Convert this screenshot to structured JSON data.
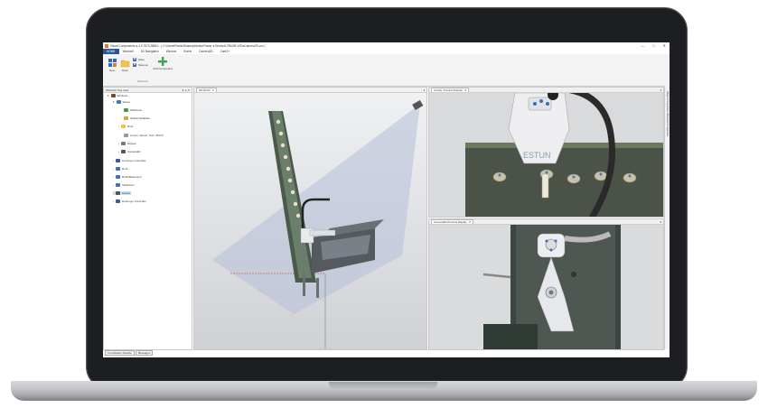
{
  "window": {
    "title": "Visual Components ● 4.0.7873.28810 - [ C:\\Users\\Public\\Desktop\\MotionFlower ● Works41784439.1\\SimCamera2D.vcx ]",
    "controls": [
      "—",
      "□",
      "✕"
    ]
  },
  "menubar": {
    "items": [
      {
        "label": "HOME",
        "active": true
      },
      {
        "label": "Workcell",
        "active": false
      },
      {
        "label": "3D Navigation",
        "active": false
      },
      {
        "label": "Window",
        "active": false
      },
      {
        "label": "Scene",
        "active": false
      },
      {
        "label": "Camera2D",
        "active": false
      },
      {
        "label": "Cam2+",
        "active": false
      }
    ]
  },
  "ribbon": {
    "new_label": "New",
    "open_label": "Open",
    "save_label": "Save",
    "save_as_label": "Save as",
    "add_component_label": "Add Component",
    "group_label": "Workcell"
  },
  "tree_panel": {
    "title": "Workcell Tree view",
    "header_controls": "▾ ⊿ ✕",
    "nodes": [
      {
        "label": "Workcell",
        "level": 0,
        "icon": "workcell-icon",
        "color": "#7a4a2a"
      },
      {
        "label": "Scene",
        "level": 1,
        "icon": "scene-icon",
        "color": "#3f79c4"
      },
      {
        "label": "3DDevice",
        "level": 2,
        "icon": "device-icon",
        "color": "#3f9c46"
      },
      {
        "label": "Global Variables",
        "level": 2,
        "icon": "variables-icon",
        "color": "#d6a43a"
      },
      {
        "label": "Root",
        "level": 2,
        "icon": "folder-icon",
        "color": "#f2c24c"
      },
      {
        "label": "Comm. Server: Port: 45770",
        "level": 2,
        "icon": "server-icon",
        "color": "#9a9a9a"
      },
      {
        "label": "Gripper",
        "level": 2,
        "icon": "gripper-icon",
        "color": "#7a7a7a"
      },
      {
        "label": "Camera2D",
        "level": 2,
        "icon": "camera-icon",
        "color": "#555555"
      },
      {
        "label": "Conveyor Controller",
        "level": 1,
        "icon": "conveyor-icon",
        "color": "#3a5a9a"
      },
      {
        "label": "Root",
        "level": 1,
        "icon": "robot-icon",
        "color": "#3f6fb0"
      },
      {
        "label": "RobotBasement",
        "level": 1,
        "icon": "robot-icon",
        "color": "#3f6fb0"
      },
      {
        "label": "TableCam",
        "level": 1,
        "icon": "robot-icon",
        "color": "#3f6fb0"
      },
      {
        "label": "Cam2+",
        "level": 1,
        "icon": "camera-icon",
        "color": "#555555",
        "selected": true
      },
      {
        "label": "Destroyer Controller",
        "level": 1,
        "icon": "conveyor-icon",
        "color": "#3a5a9a"
      }
    ],
    "bottom_tabs": [
      "Compilation Results",
      "Messages"
    ]
  },
  "view3d": {
    "tab_label": "3D World",
    "close": "✕",
    "menu": "▾"
  },
  "preview1": {
    "tab_label": "Cam2+ Preview Display",
    "close": "✕",
    "menu": "▾",
    "brand_text": "ESTUN"
  },
  "preview2": {
    "tab_label": "Camera2D Preview Display",
    "close": "✕",
    "menu": "▾"
  },
  "side_strip": {
    "label": "Object Properties   Workcell Properties"
  }
}
